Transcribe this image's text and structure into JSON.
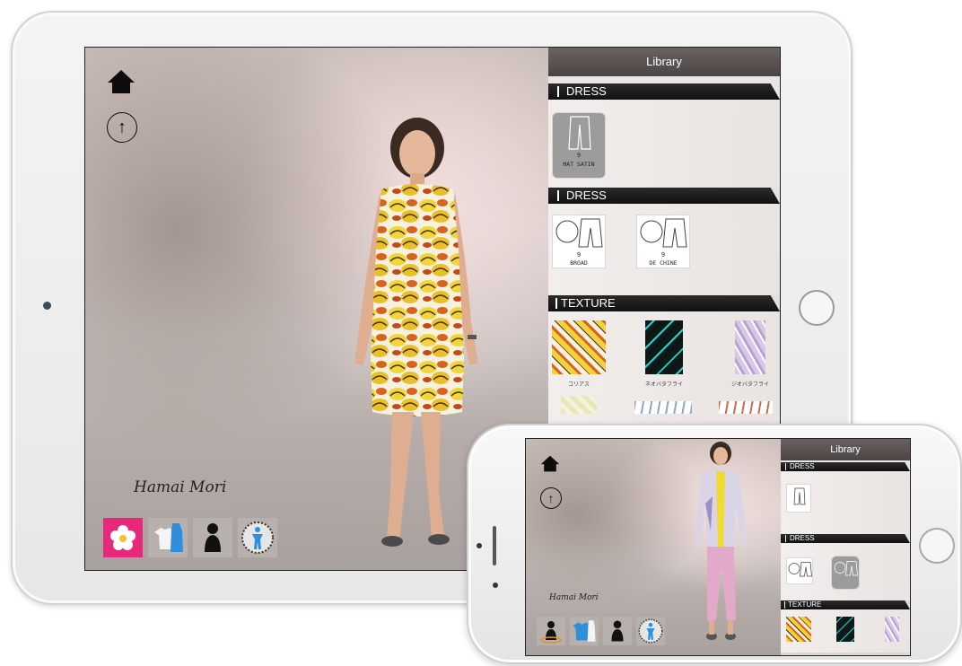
{
  "ipad": {
    "library_title": "Library",
    "sections": [
      {
        "title": "DRESS",
        "items": [
          {
            "num": "9",
            "name": "MAT SATIN",
            "selected": true
          }
        ]
      },
      {
        "title": "DRESS",
        "items": [
          {
            "num": "9",
            "name": "BROAD",
            "selected": false
          },
          {
            "num": "9",
            "name": "DE CHINE",
            "selected": false
          }
        ]
      },
      {
        "title": "TEXTURE",
        "items": [
          {
            "name": "コリアス"
          },
          {
            "name": "ネオバタフライ"
          },
          {
            "name": "ジオバタフライ"
          }
        ]
      }
    ],
    "signature": "Hamai Mori",
    "toolbar": [
      "flower-icon",
      "clothes-icon",
      "person-icon",
      "body-dial-icon"
    ]
  },
  "iphone": {
    "library_title": "Library",
    "sections": [
      {
        "title": "DRESS"
      },
      {
        "title": "DRESS"
      },
      {
        "title": "TEXTURE"
      }
    ],
    "signature": "Hamai Mori",
    "toolbar": [
      "avatar-ring-icon",
      "clothes-icon",
      "person-icon",
      "body-dial-icon"
    ]
  },
  "colors": {
    "accent": "#e8287a",
    "header": "#4a4443",
    "section": "#111111"
  }
}
